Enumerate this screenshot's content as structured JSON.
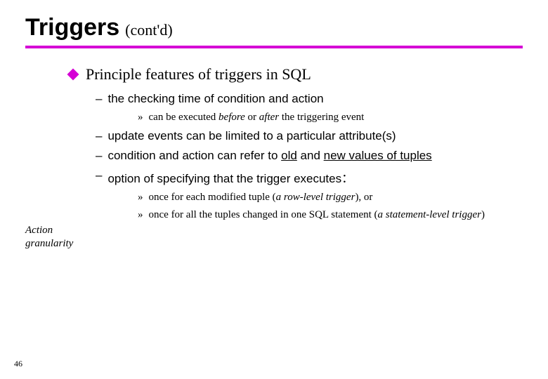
{
  "title": {
    "main": "Triggers",
    "sub": "(cont'd)"
  },
  "bullet1": "Principle features of triggers in SQL",
  "sub1": "the checking time of condition and action",
  "sub1detail_pre": "can be executed ",
  "sub1detail_before": "before",
  "sub1detail_mid": " or ",
  "sub1detail_after": "after",
  "sub1detail_post": " the triggering event",
  "sub2": "update events can be limited to a particular attribute(s)",
  "sub3_pre": "condition and action can refer to ",
  "sub3_old": "old",
  "sub3_and": " and ",
  "sub3_new": "new values of tuples",
  "sub4": "option of specifying that the trigger executes：",
  "opt1_pre": "once for each modified tuple (",
  "opt1_em": "a row-level trigger",
  "opt1_post": "), or",
  "opt2_pre": "once for all the tuples changed in one SQL statement (",
  "opt2_em": "a statement-level trigger",
  "opt2_post": ")",
  "sidelabel_l1": "Action",
  "sidelabel_l2": "granularity",
  "page_number": "46"
}
